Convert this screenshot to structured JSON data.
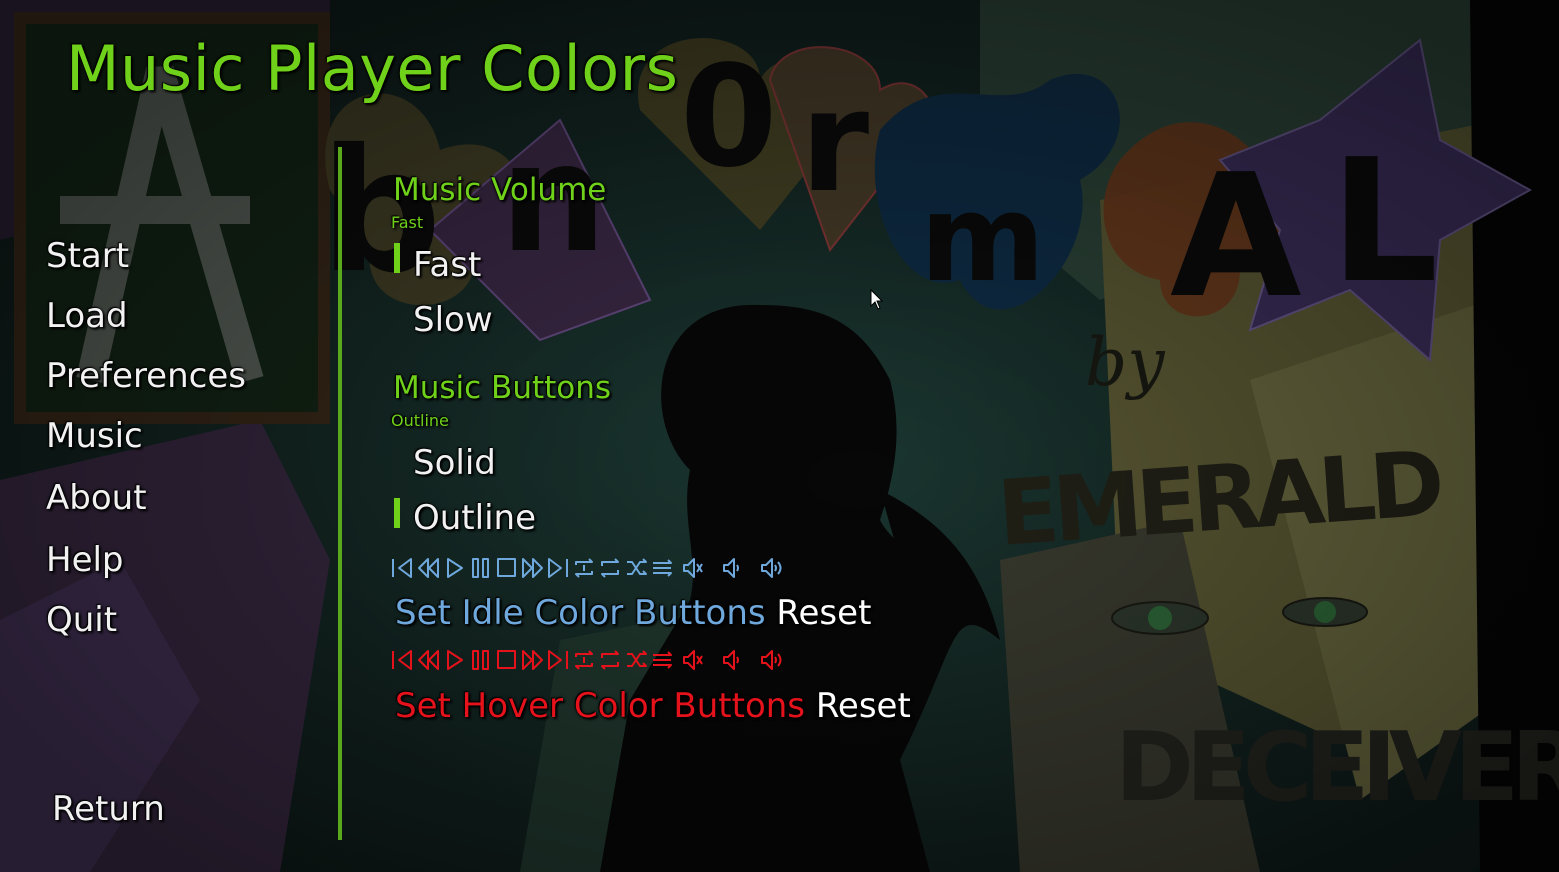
{
  "screen": {
    "title": "Music Player Colors"
  },
  "background": {
    "logo_text": "AbnOrmAL",
    "byline": "by",
    "studio_line1": "EMERALD",
    "studio_line2": "DECEIVERS"
  },
  "nav": {
    "items": [
      {
        "label": "Start",
        "icon": "none"
      },
      {
        "label": "Load",
        "icon": "none"
      },
      {
        "label": "Preferences",
        "icon": "none"
      },
      {
        "label": "Music",
        "icon": "none"
      },
      {
        "label": "About",
        "icon": "none"
      },
      {
        "label": "Help",
        "icon": "none"
      },
      {
        "label": "Quit",
        "icon": "none"
      }
    ],
    "return_label": "Return"
  },
  "music_volume": {
    "label": "Music Volume",
    "current": "Fast",
    "options": [
      "Fast",
      "Slow"
    ],
    "selected": "Fast"
  },
  "music_buttons": {
    "label": "Music Buttons",
    "current": "Outline",
    "options": [
      "Solid",
      "Outline"
    ],
    "selected": "Outline"
  },
  "player_icons": [
    "skip-back-icon",
    "rewind-icon",
    "play-icon",
    "pause-icon",
    "stop-icon",
    "fast-forward-icon",
    "skip-forward-icon",
    "repeat-one-icon",
    "repeat-icon",
    "shuffle-icon",
    "queue-icon",
    "mute-icon",
    "volume-down-icon",
    "volume-up-icon"
  ],
  "idle_color": {
    "set_label": "Set Idle Color Buttons",
    "reset_label": "Reset",
    "color": "#6fa8dc"
  },
  "hover_color": {
    "set_label": "Set Hover Color Buttons",
    "reset_label": "Reset",
    "color": "#e6121b"
  },
  "theme": {
    "accent": "#6fd11a",
    "text": "#f2f2f2"
  }
}
